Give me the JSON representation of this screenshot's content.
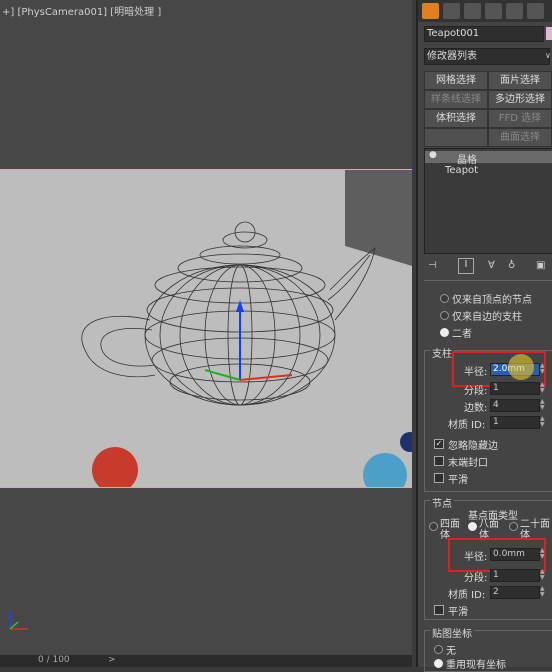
{
  "viewport": {
    "label": "+] [PhysCamera001] [明暗处理 ]",
    "timeline": "0 / 100",
    "timeline_arrow": ">"
  },
  "panel": {
    "object_name": "Teapot001",
    "modifier_list": "修改器列表",
    "buttons": [
      {
        "label": "网格选择",
        "dim": false
      },
      {
        "label": "面片选择",
        "dim": false
      },
      {
        "label": "样条线选择",
        "dim": true
      },
      {
        "label": "多边形选择",
        "dim": false
      },
      {
        "label": "体积选择",
        "dim": false
      },
      {
        "label": "FFD 选择",
        "dim": true
      },
      {
        "label": "",
        "dim": false
      },
      {
        "label": "曲面选择",
        "dim": true
      }
    ],
    "stack": {
      "modifier": "晶格",
      "base": "Teapot"
    },
    "geometry_options": [
      "仅来自顶点的节点",
      "仅来自边的支柱",
      "二者"
    ],
    "geometry_selected": 2,
    "struts": {
      "title": "支柱",
      "radius_label": "半径:",
      "radius": "2.0mm",
      "segments_label": "分段:",
      "segments": "1",
      "sides_label": "边数:",
      "sides": "4",
      "matid_label": "材质 ID:",
      "matid": "1",
      "ignore_hidden": "忽略隐藏边",
      "end_caps": "末端封口",
      "smooth": "平滑"
    },
    "joints": {
      "title": "节点",
      "base_type": "基点面类型",
      "types": [
        "四面体",
        "八面体",
        "二十面体"
      ],
      "type_selected": 1,
      "radius_label": "半径:",
      "radius": "0.0mm",
      "segments_label": "分段:",
      "segments": "1",
      "matid_label": "材质 ID:",
      "matid": "2",
      "smooth": "平滑"
    },
    "mapping": {
      "title": "贴图坐标",
      "options": [
        "无",
        "重用现有坐标"
      ],
      "selected": 1
    }
  }
}
